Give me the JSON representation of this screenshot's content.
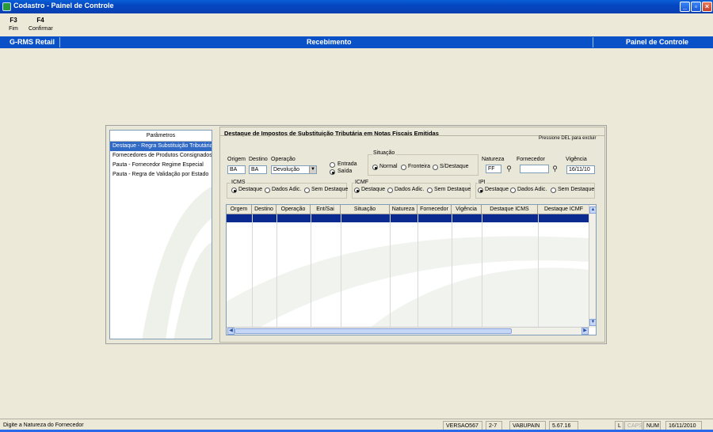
{
  "window": {
    "title": "Codastro - Painel de Controle"
  },
  "fkeys": [
    {
      "key": "F3",
      "label": "Fim"
    },
    {
      "key": "F4",
      "label": "Confirmar"
    }
  ],
  "header": {
    "left": "G-RMS Retail",
    "center": "Recebimento",
    "right": "Painel de Controle"
  },
  "params": {
    "title": "Parâmetros",
    "items": [
      "Destaque - Regra Substituição Tributária",
      "Fornecedores de Produtos Consignados",
      "Pauta - Fornecedor Regime Especial",
      "Pauta - Regra de Validação por Estado"
    ]
  },
  "form": {
    "title": "Destaque de Impostos de Substituição Tributária em Notas Fiscais Emitidas",
    "del_note": "Pressione DEL para excluir",
    "origem_label": "Origem",
    "origem_value": "BA",
    "destino_label": "Destino",
    "destino_value": "BA",
    "operacao_label": "Operação",
    "operacao_value": "Devolução",
    "entrada_label": "Entrada",
    "saida_label": "Saída",
    "situacao_label": "Situação",
    "situacao_normal": "Normal",
    "situacao_fronteira": "Fronteira",
    "situacao_sdestaque": "S/Destaque",
    "natureza_label": "Natureza",
    "natureza_value": "FF",
    "fornecedor_label": "Fornecedor",
    "fornecedor_value": "",
    "vigencia_label": "Vigência",
    "vigencia_value": "16/11/10",
    "icms_label": "ICMS",
    "icmf_label": "ICMF",
    "ipi_label": "IPI",
    "opt_destaque": "Destaque",
    "opt_dados": "Dados Adic.",
    "opt_sem": "Sem Destaque"
  },
  "grid": {
    "columns": [
      "Orgem",
      "Destino",
      "Operação",
      "Ent/Sai",
      "Situação",
      "Natureza",
      "Fornecedor",
      "Vigência",
      "Destaque ICMS",
      "Destaque ICMF"
    ]
  },
  "status": {
    "message": "Digite a Natureza do Fornecedor",
    "version": "VERSAO567",
    "code": "2-7",
    "user": "VABUPAIN",
    "build": "5.67.16",
    "l": "L",
    "caps": "CAPS",
    "num": "NUM",
    "date": "16/11/2010"
  },
  "colors": {
    "accent": "#0a51c8",
    "selection": "#316ac5",
    "grid_selection": "#0a2a90"
  }
}
